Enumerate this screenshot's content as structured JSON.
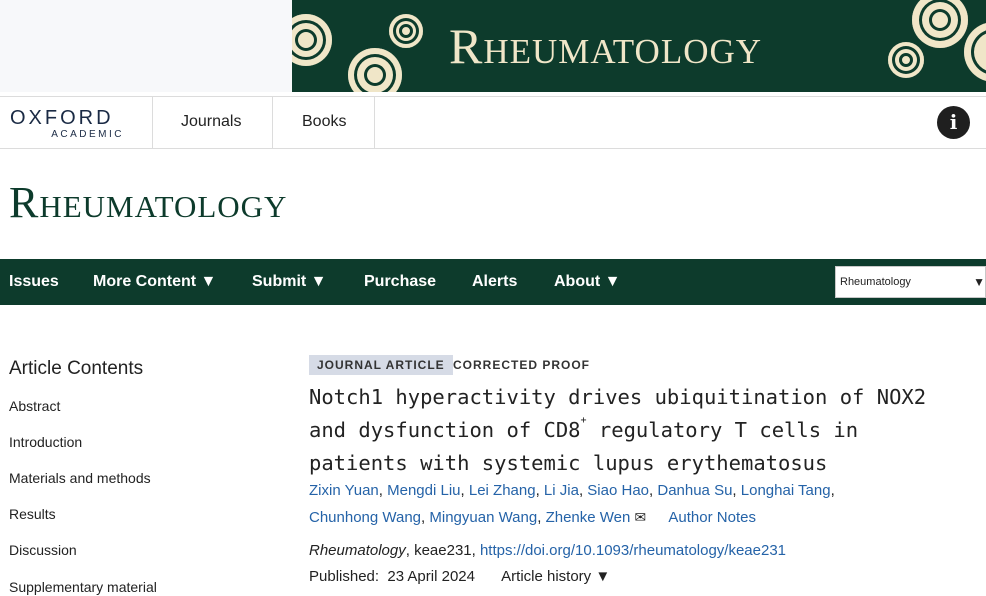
{
  "banner": {
    "title": "Rheumatology"
  },
  "header": {
    "logo_top": "OXFORD",
    "logo_bottom": "ACADEMIC",
    "links": [
      "Journals",
      "Books"
    ],
    "info_icon": "i"
  },
  "journal": {
    "title": "Rheumatology"
  },
  "nav": {
    "items": [
      "Issues",
      "More Content ▼",
      "Submit ▼",
      "Purchase",
      "Alerts",
      "About ▼"
    ],
    "select_value": "Rheumatology",
    "select_arrow": "▼"
  },
  "sidebar": {
    "title": "Article Contents",
    "items": [
      "Abstract",
      "Introduction",
      "Materials and methods",
      "Results",
      "Discussion",
      "Supplementary material"
    ]
  },
  "article": {
    "type_badge": "JOURNAL ARTICLE",
    "status_badge": "CORRECTED PROOF",
    "title_line1": "Notch1 hyperactivity drives ubiquitination of NOX2",
    "title_line2_a": "and dysfunction of CD8",
    "title_line2_sup": "+",
    "title_line2_b": " regulatory T cells in",
    "title_line3": "patients with systemic lupus erythematosus",
    "authors": [
      "Zixin Yuan",
      "Mengdi Liu",
      "Lei Zhang",
      "Li Jia",
      "Siao Hao",
      "Danhua Su",
      "Longhai Tang",
      "Chunhong Wang",
      "Mingyuan Wang",
      "Zhenke Wen"
    ],
    "mail_icon": "✉",
    "author_notes": "Author Notes",
    "citation_journal": "Rheumatology",
    "citation_id": ", keae231, ",
    "doi": "https://doi.org/10.1093/rheumatology/keae231",
    "published_label": "Published:",
    "published_date": "23 April 2024",
    "history_label": "Article history ▼"
  },
  "colors": {
    "brand_green": "#0d3b2c",
    "banner_text": "#f0e6c8",
    "link_blue": "#2563a8"
  }
}
